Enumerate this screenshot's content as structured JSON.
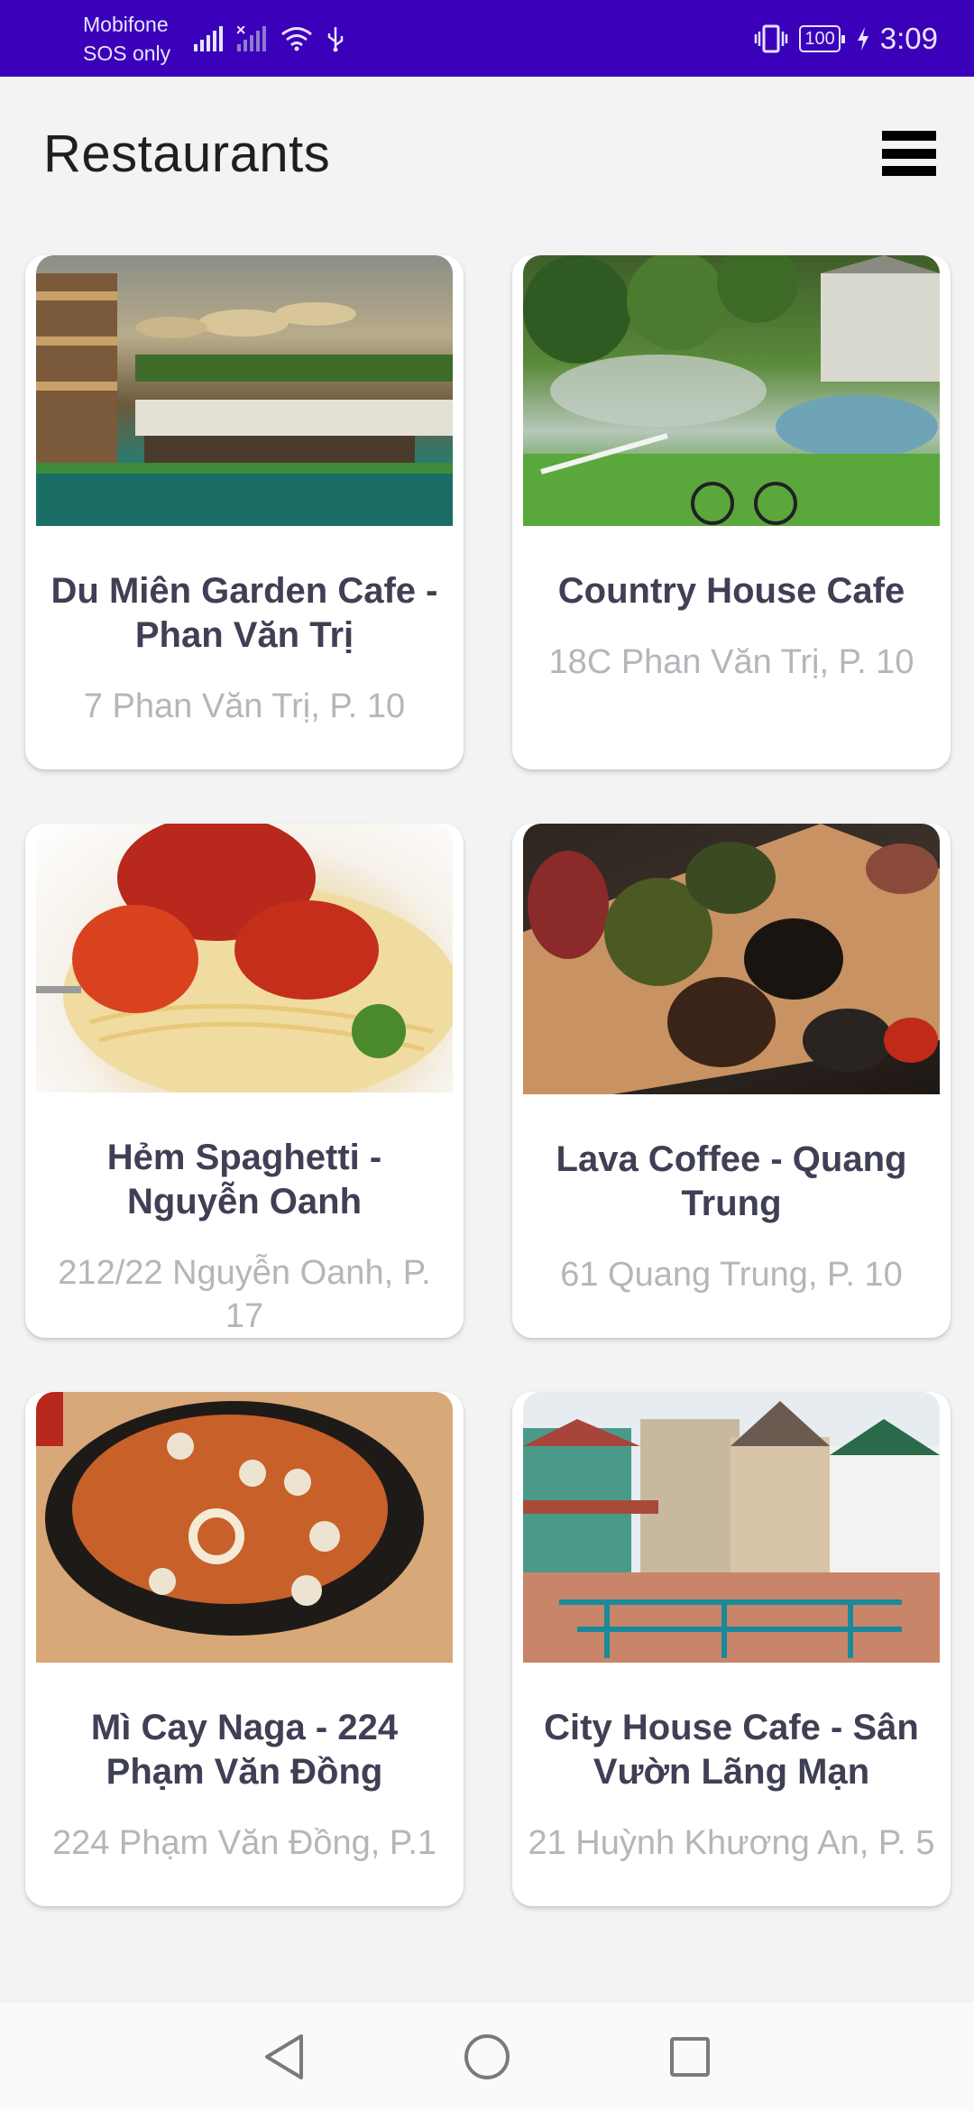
{
  "status_bar": {
    "carrier": "Mobifone",
    "carrier_status": "SOS only",
    "battery": "100",
    "time": "3:09",
    "background_color": "#3b00b9"
  },
  "app_bar": {
    "title": "Restaurants",
    "menu_icon": "menu-icon"
  },
  "restaurants": [
    {
      "name": "Du Miên Garden Cafe - Phan Văn Trị",
      "address": "7 Phan Văn Trị, P. 10",
      "image": "garden-cafe-photo"
    },
    {
      "name": "Country House Cafe",
      "address": "18C Phan Văn Trị, P. 10",
      "image": "country-house-photo"
    },
    {
      "name": "Hẻm Spaghetti - Nguyễn Oanh",
      "address": "212/22 Nguyễn Oanh, P. 17",
      "image": "spaghetti-photo"
    },
    {
      "name": "Lava Coffee - Quang Trung",
      "address": "61 Quang Trung, P. 10",
      "image": "lava-cakes-photo"
    },
    {
      "name": "Mì Cay Naga - 224 Phạm Văn Đồng",
      "address": "224 Phạm Văn Đồng, P.1",
      "image": "spicy-noodle-photo"
    },
    {
      "name": "City House Cafe - Sân Vườn Lãng Mạn",
      "address": "21 Huỳnh Khương An, P. 5",
      "image": "city-house-photo"
    }
  ],
  "nav_bar": {
    "back_icon": "back-icon",
    "home_icon": "home-icon",
    "recents_icon": "recents-icon"
  }
}
